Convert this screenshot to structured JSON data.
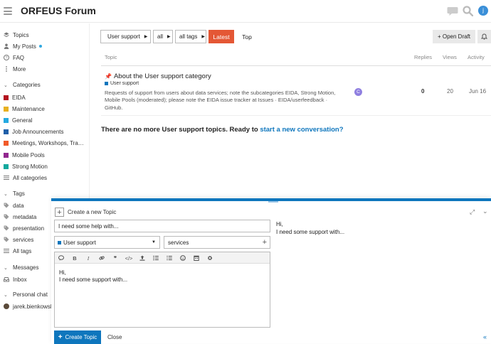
{
  "header": {
    "title": "ORFEUS Forum",
    "avatar_letter": "j"
  },
  "sidebar": {
    "nav": [
      {
        "label": "Topics",
        "icon": "layers-icon"
      },
      {
        "label": "My Posts",
        "icon": "user-icon"
      },
      {
        "label": "FAQ",
        "icon": "question-icon"
      },
      {
        "label": "More",
        "icon": "more-icon"
      }
    ],
    "categories_header": "Categories",
    "categories": [
      {
        "label": "EIDA",
        "color": "#b3121f"
      },
      {
        "label": "Maintenance",
        "color": "#e8b020"
      },
      {
        "label": "General",
        "color": "#25aae1"
      },
      {
        "label": "Job Announcements",
        "color": "#1f5fa8"
      },
      {
        "label": "Meetings, Workshops, Tra…",
        "color": "#f15a29"
      },
      {
        "label": "Mobile Pools",
        "color": "#92278f"
      },
      {
        "label": "Strong Motion",
        "color": "#12a89d"
      }
    ],
    "all_categories": "All categories",
    "tags_header": "Tags",
    "tags": [
      "data",
      "metadata",
      "presentation",
      "services"
    ],
    "all_tags": "All tags",
    "messages_header": "Messages",
    "inbox": "Inbox",
    "chat_header": "Personal chat",
    "chat_user": "jarek.bienkowsk"
  },
  "controls": {
    "category": "User support",
    "category_color": "#0e76bd",
    "subcategory": "all",
    "tags": "all tags",
    "latest": "Latest",
    "top": "Top",
    "open_draft": "+ Open Draft"
  },
  "table": {
    "headers": {
      "topic": "Topic",
      "replies": "Replies",
      "views": "Views",
      "activity": "Activity"
    },
    "topic": {
      "title": "About the User support category",
      "category": "User support",
      "excerpt": "Requests of support from users about data services; note the subcategories EIDA, Strong Motion, Mobile Pools (moderated); please note the EIDA issue tracker at Issues · EIDA/userfeedback · GitHub.",
      "poster_letter": "C",
      "replies": "0",
      "views": "20",
      "activity": "Jun 16"
    },
    "no_more": "There are no more User support topics. Ready to ",
    "no_more_link": "start a new conversation?"
  },
  "composer": {
    "action": "Create a new Topic",
    "title_value": "I need some help with...",
    "category": "User support",
    "tag": "services",
    "body": "Hi,\nI need some support with...",
    "preview": "Hi,\nI need some support with...",
    "create_label": "Create Topic",
    "close_label": "Close"
  }
}
